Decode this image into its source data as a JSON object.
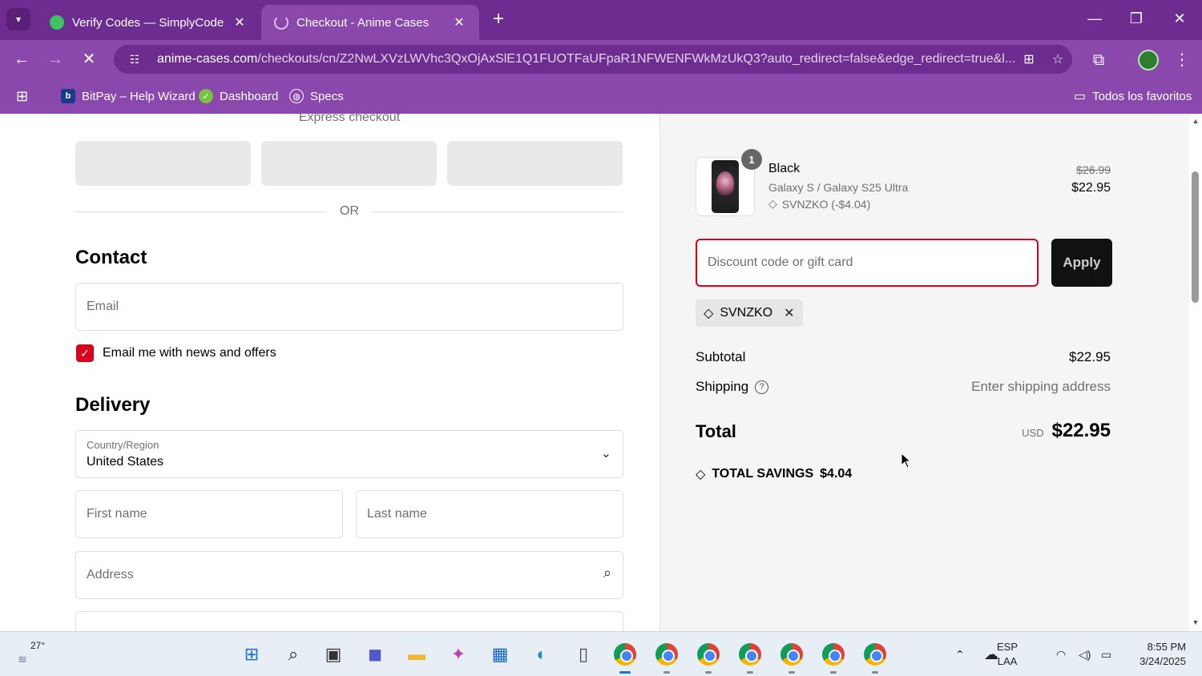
{
  "browser": {
    "tabs": [
      {
        "title": "Verify Codes — SimplyCodes",
        "active": false
      },
      {
        "title": "Checkout - Anime Cases",
        "active": true
      }
    ],
    "url_host": "anime-cases.com",
    "url_path": "/checkouts/cn/Z2NwLXVzLWVhc3QxOjAxSlE1Q1FUOTFaUFpaR1NFWENFWkMzUkQ3?auto_redirect=false&edge_redirect=true&l...",
    "bookmarks": [
      "BitPay – Help Wizard",
      "Dashboard",
      "Specs"
    ],
    "favorites_label": "Todos los favoritos",
    "accent": "#8a48ad"
  },
  "checkout": {
    "express_label": "Express checkout",
    "or_label": "OR",
    "contact_heading": "Contact",
    "email_placeholder": "Email",
    "newsletter_label": "Email me with news and offers",
    "delivery_heading": "Delivery",
    "country_label": "Country/Region",
    "country_value": "United States",
    "first_name_placeholder": "First name",
    "last_name_placeholder": "Last name",
    "address_placeholder": "Address"
  },
  "summary": {
    "item": {
      "quantity": "1",
      "name": "Black",
      "variant": "Galaxy S / Galaxy S25 Ultra",
      "discount": "SVNZKO (-$4.04)",
      "original_price": "$26.99",
      "price": "$22.95"
    },
    "discount_placeholder": "Discount code or gift card",
    "apply_label": "Apply",
    "applied_code": "SVNZKO",
    "subtotal_label": "Subtotal",
    "subtotal_value": "$22.95",
    "shipping_label": "Shipping",
    "shipping_value": "Enter shipping address",
    "total_label": "Total",
    "total_currency": "USD",
    "total_value": "$22.95",
    "savings_label": "TOTAL SAVINGS",
    "savings_value": "$4.04"
  },
  "taskbar": {
    "temperature": "27°",
    "lang_top": "ESP",
    "lang_bottom": "LAA",
    "time": "8:55 PM",
    "date": "3/24/2025"
  }
}
